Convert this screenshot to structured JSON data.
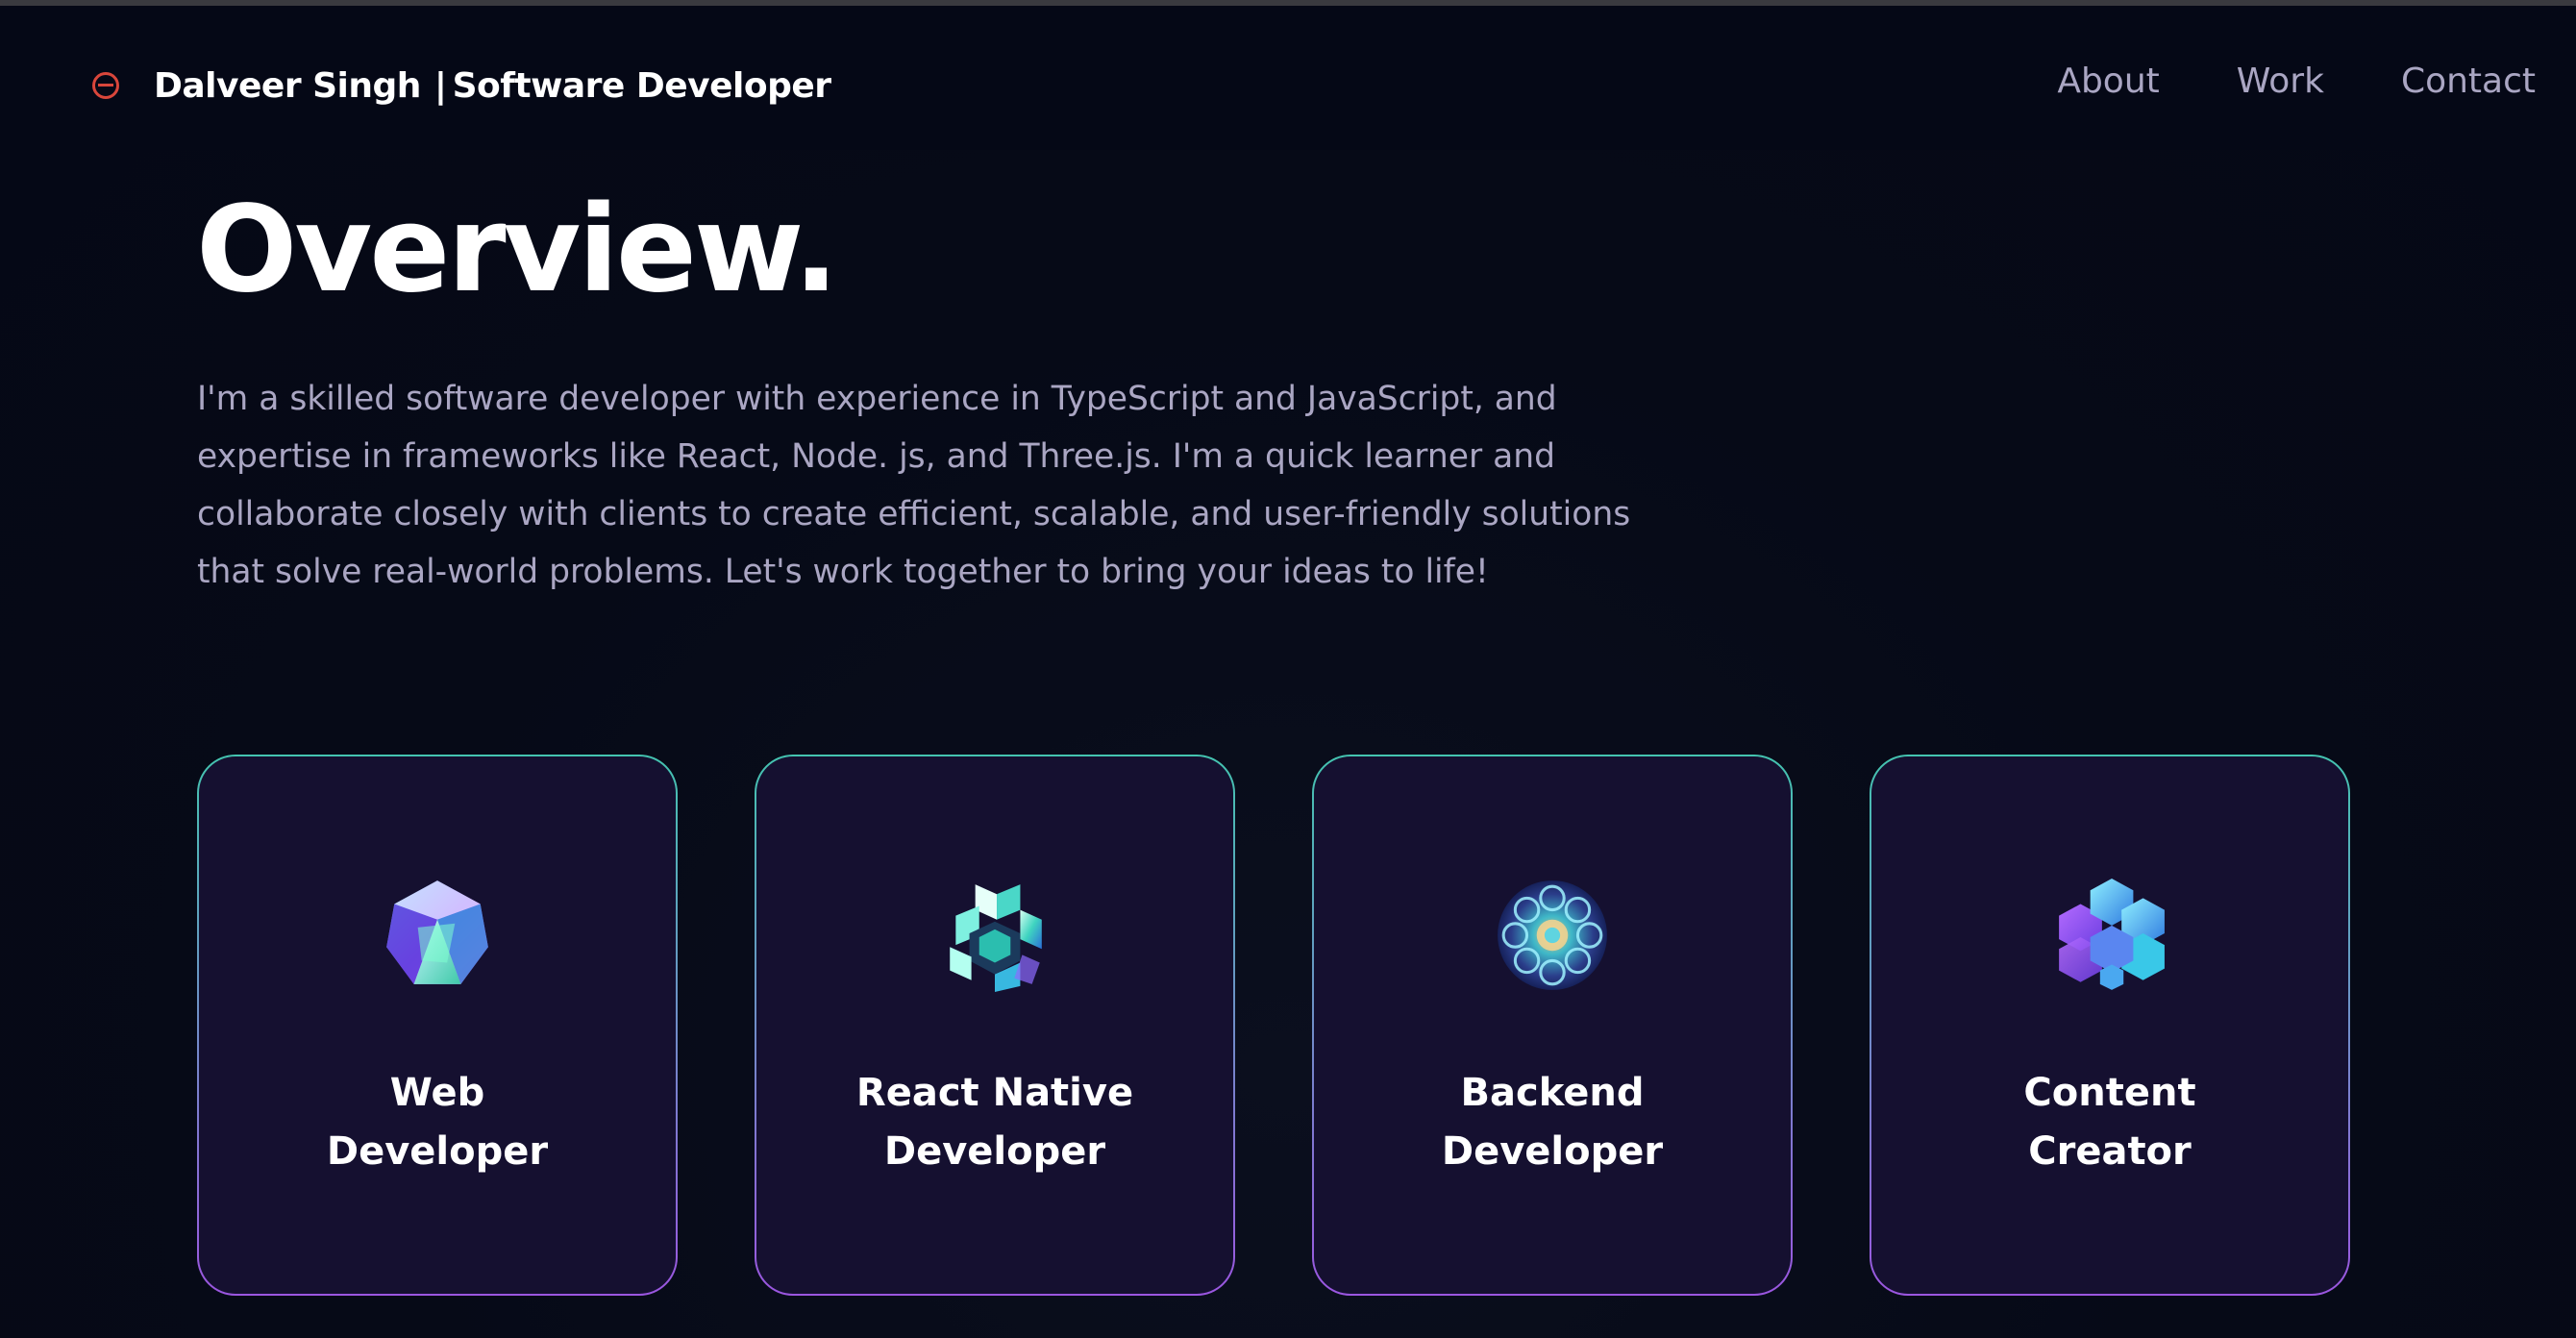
{
  "navbar": {
    "brand_name": "Dalveer Singh",
    "brand_separator": "|",
    "brand_role": "Software Developer",
    "links": [
      {
        "label": "About"
      },
      {
        "label": "Work"
      },
      {
        "label": "Contact"
      }
    ]
  },
  "overview": {
    "heading": "Overview.",
    "paragraph": "I'm a skilled software developer with experience in TypeScript and JavaScript, and expertise in frameworks like React, Node. js, and Three.js. I'm a quick learner and collaborate closely with clients to create efficient, scalable, and user-friendly solutions that solve real-world problems. Let's work together to bring your ideas to life!"
  },
  "services": [
    {
      "title_line1": "Web",
      "title_line2": "Developer",
      "icon": "web-developer-icon"
    },
    {
      "title_line1": "React Native",
      "title_line2": "Developer",
      "icon": "react-native-developer-icon"
    },
    {
      "title_line1": "Backend",
      "title_line2": "Developer",
      "icon": "backend-developer-icon"
    },
    {
      "title_line1": "Content",
      "title_line2": "Creator",
      "icon": "content-creator-icon"
    }
  ],
  "colors": {
    "background": "#050816",
    "card_background": "#151030",
    "card_border_top": "#44c4b0",
    "card_border_bottom": "#9b56e0",
    "secondary_text": "#aaa6c3",
    "logo_accent": "#d9463b"
  }
}
